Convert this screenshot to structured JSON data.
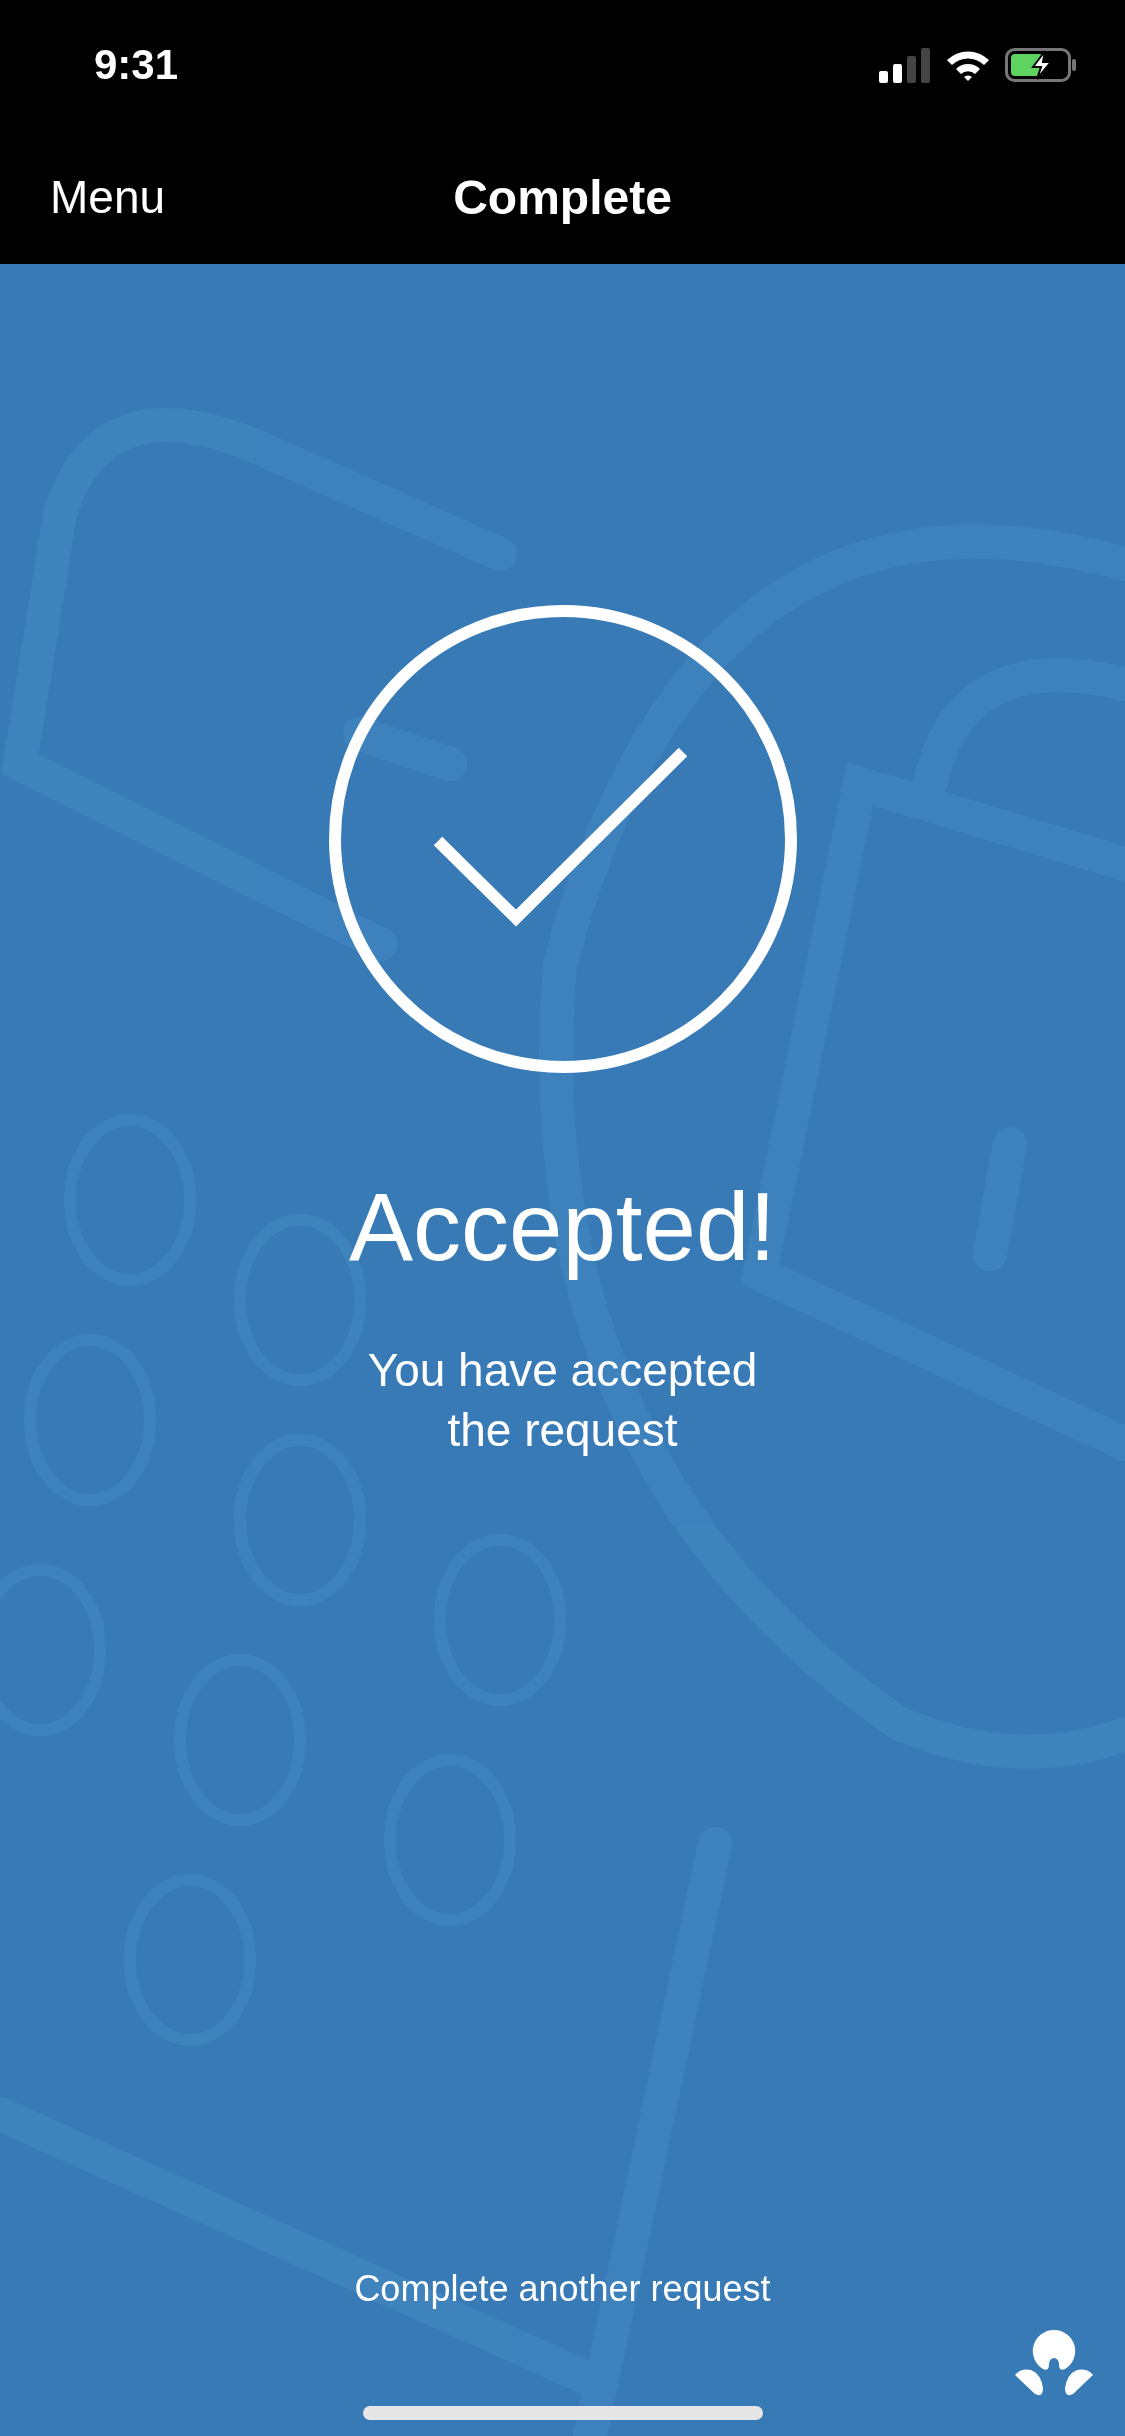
{
  "status_bar": {
    "time": "9:31"
  },
  "nav_bar": {
    "left_button": "Menu",
    "title": "Complete"
  },
  "result": {
    "heading": "Accepted!",
    "message_lines": [
      "You have accepted",
      "the request"
    ]
  },
  "link": "Complete another request"
}
